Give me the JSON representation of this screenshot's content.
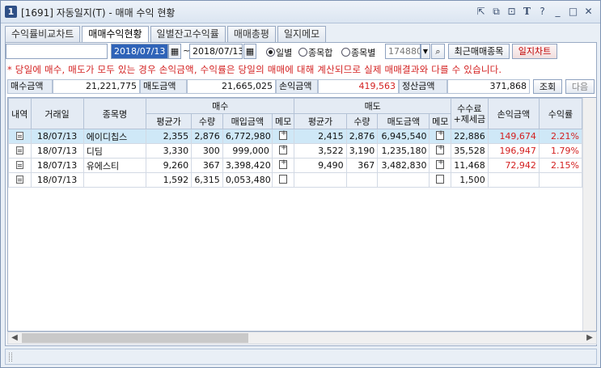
{
  "window": {
    "number": "1",
    "title": "[1691] 자동일지(T) - 매매 수익 현황",
    "icons": [
      "link-icon",
      "window-icon",
      "lock-icon",
      "font-icon",
      "help-icon",
      "minimize-icon",
      "maximize-icon",
      "close-icon"
    ]
  },
  "tabs": [
    {
      "label": "수익률비교차트",
      "active": false
    },
    {
      "label": "매매수익현황",
      "active": true
    },
    {
      "label": "일별잔고수익률",
      "active": false
    },
    {
      "label": "매매총평",
      "active": false
    },
    {
      "label": "일지메모",
      "active": false
    }
  ],
  "controls": {
    "account_value": "",
    "date_from": "2018/07/13",
    "tilde": "~",
    "date_to": "2018/07/13",
    "radio_daily": "일별",
    "radio_stock_sum": "종목합",
    "radio_by_stock": "종목별",
    "stock_code": "174880",
    "recent_button": "최근매매종목",
    "chart_button": "일지차트"
  },
  "notice": "* 당일에 매수, 매도가 모두 있는 경우 손익금액, 수익률은 당일의 매매에 대해 계산되므로 실제 매매결과와 다를 수 있습니다.",
  "summary": {
    "buy_label": "매수금액",
    "buy_value": "21,221,775",
    "sell_label": "매도금액",
    "sell_value": "21,665,025",
    "profit_label": "손익금액",
    "profit_value": "419,563",
    "settle_label": "정산금액",
    "settle_value": "371,868",
    "query_button": "조회",
    "next_button": "다음"
  },
  "grid": {
    "headers": {
      "detail": "내역",
      "date": "거래일",
      "name": "종목명",
      "buy_group": "매수",
      "sell_group": "매도",
      "fee": "수수료\n+제세금",
      "fee_line1": "수수료",
      "fee_line2": "+제세금",
      "profit": "손익금액",
      "rate": "수익률",
      "avg": "평균가",
      "qty": "수량",
      "buy_amt": "매입금액",
      "memo": "메모",
      "sell_avg": "평균가",
      "sell_qty": "수량",
      "sell_amt": "매도금액",
      "sell_memo": "메모"
    },
    "rows": [
      {
        "date": "18/07/13",
        "name": "에이디칩스",
        "buy_avg": "2,355",
        "buy_qty": "2,876",
        "buy_amt": "6,772,980",
        "sell_avg": "2,415",
        "sell_qty": "2,876",
        "sell_amt": "6,945,540",
        "fee": "22,886",
        "profit": "149,674",
        "rate": "2.21%",
        "selected": true
      },
      {
        "date": "18/07/13",
        "name": "디딤",
        "buy_avg": "3,330",
        "buy_qty": "300",
        "buy_amt": "999,000",
        "sell_avg": "3,522",
        "sell_qty": "3,190",
        "sell_amt": "1,235,180",
        "fee": "35,528",
        "profit": "196,947",
        "rate": "1.79%",
        "selected": false
      },
      {
        "date": "18/07/13",
        "name": "유에스티",
        "buy_avg": "9,260",
        "buy_qty": "367",
        "buy_amt": "3,398,420",
        "sell_avg": "9,490",
        "sell_qty": "367",
        "sell_amt": "3,482,830",
        "fee": "11,468",
        "profit": "72,942",
        "rate": "2.15%",
        "selected": false
      },
      {
        "date": "18/07/13",
        "name": "",
        "buy_avg": "1,592",
        "buy_qty": "6,315",
        "buy_amt": "0,053,480",
        "sell_avg": "",
        "sell_qty": "",
        "sell_amt": "",
        "fee": "1,500",
        "profit": "",
        "rate": "",
        "selected": false
      }
    ]
  }
}
